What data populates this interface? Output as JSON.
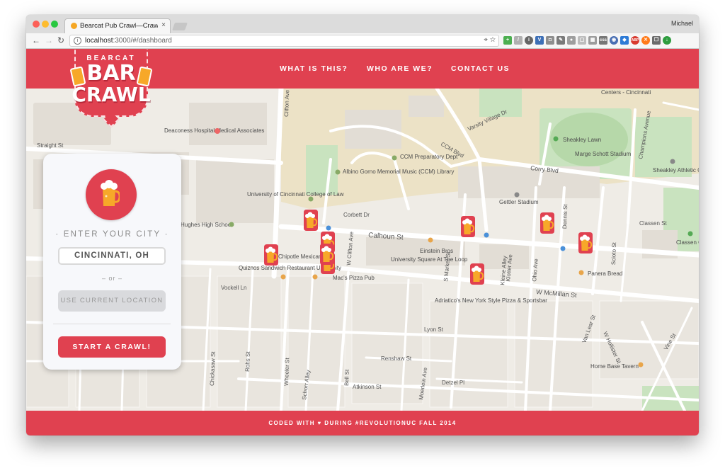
{
  "browser": {
    "tab_title": "Bearcat Pub Crawl—Crawl like",
    "tab_close": "×",
    "profile_name": "Michael",
    "url_host": "localhost",
    "url_rest": ":3000/#/dashboard"
  },
  "header": {
    "logo_top": "BEARCAT",
    "logo_bar": "BAR",
    "logo_crawl": "CRAWL",
    "nav": [
      "WHAT IS THIS?",
      "WHO ARE WE?",
      "CONTACT US"
    ]
  },
  "panel": {
    "label": "· ENTER YOUR CITY ·",
    "city_value": "CINCINNATI, OH",
    "or_text": "– or –",
    "use_location_label": "USE CURRENT LOCATION",
    "start_label": "START A CRAWL!"
  },
  "footer": {
    "before": "CODED WITH ",
    "heart": "♥",
    "after": " DURING #REVOLUTIONUC FALL 2014"
  },
  "map": {
    "places": [
      "Centers - Cincinnati",
      "Deaconess Hospital Medical Associates",
      "CCM Preparatory Dept",
      "Albino Gorno Memorial Music (CCM) Library",
      "University of Cincinnati College of Law",
      "Sheakley Lawn",
      "Marge Schott Stadium",
      "Sheakley Athletic Complex",
      "Gettler Stadium",
      "Hughes High School",
      "Chipotle Mexican Grill",
      "Quiznos Sandwich Restaurant University",
      "Einstein Bros",
      "University Square At The Loop",
      "Mac's Pizza Pub",
      "Panera Bread",
      "Adriatico's New York Style Pizza & Sportsbar",
      "Home Base Tavern",
      "Classen Gr"
    ],
    "streets": [
      "Straight St",
      "Clifton Ave",
      "Corbett Dr",
      "Calhoun St",
      "Corry Blvd",
      "CCM Blvd",
      "Varsity Village Dr",
      "W McMillan St",
      "Vockell Ln",
      "Lyon St",
      "Renshaw St",
      "Atkinson St",
      "Detzel Pl",
      "Classen St",
      "Dennis St",
      "Scioto St",
      "Champions Avenue",
      "Ohio Ave",
      "Klotter Ave",
      "S Market St",
      "Rohs St",
      "Wheeler St",
      "Schorr Alley",
      "Chickasaw St",
      "Moerlein Ave",
      "Bell St",
      "W Hollister St",
      "Van Lear St",
      "Vine St",
      "W Clifton Ave",
      "Kleine Alley"
    ],
    "marker_count": 9
  }
}
